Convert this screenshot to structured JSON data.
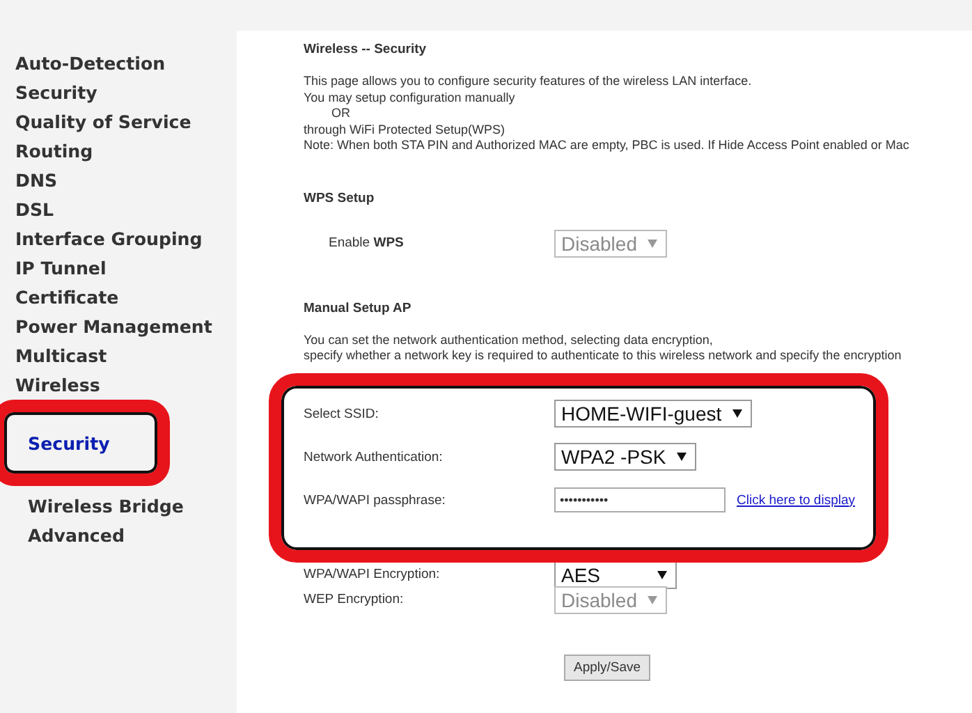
{
  "sidebar": {
    "items": [
      {
        "label": "Auto-Detection",
        "selected": false
      },
      {
        "label": "Security",
        "selected": false
      },
      {
        "label": "Quality of Service",
        "selected": false
      },
      {
        "label": "Routing",
        "selected": false
      },
      {
        "label": "DNS",
        "selected": false
      },
      {
        "label": "DSL",
        "selected": false
      },
      {
        "label": "Interface Grouping",
        "selected": false
      },
      {
        "label": "IP Tunnel",
        "selected": false
      },
      {
        "label": "Certificate",
        "selected": false
      },
      {
        "label": "Power Management",
        "selected": false
      },
      {
        "label": "Multicast",
        "selected": false
      },
      {
        "label": "Wireless",
        "selected": false,
        "children": [
          {
            "label": "Security",
            "selected": true
          },
          {
            "label": "Wireless Bridge",
            "selected": false
          },
          {
            "label": "Advanced",
            "selected": false
          }
        ]
      }
    ]
  },
  "page": {
    "title": "Wireless -- Security",
    "intro": [
      "This page allows you to configure security features of the wireless LAN interface.",
      "You may setup configuration manually",
      "OR",
      "through WiFi Protected Setup(WPS)",
      "Note: When both STA PIN and Authorized MAC are empty, PBC is used. If Hide Access Point enabled or Mac"
    ]
  },
  "wps": {
    "heading": "WPS Setup",
    "label": "Enable **WPS**",
    "value": "Disabled",
    "disabled": true
  },
  "manual": {
    "heading": "Manual Setup AP",
    "description": [
      "You can set the network authentication method, selecting data encryption,",
      "specify whether a network key is required to authenticate to this wireless network and specify the encryption"
    ],
    "fields": [
      {
        "kind": "select",
        "label": "Select SSID:",
        "value": "HOME-WIFI-guest",
        "disabled": false,
        "highlighted": true
      },
      {
        "kind": "select",
        "label": "Network Authentication:",
        "value": "WPA2 -PSK",
        "disabled": false,
        "highlighted": true
      },
      {
        "kind": "password",
        "label": "WPA/WAPI passphrase:",
        "value": "•••••••••••",
        "link": "Click here to display",
        "highlighted": true
      },
      {
        "kind": "select",
        "label": "WPA/WAPI Encryption:",
        "value": "AES",
        "disabled": false,
        "highlighted": false
      },
      {
        "kind": "select",
        "label": "WEP Encryption:",
        "value": "Disabled",
        "disabled": true,
        "highlighted": false
      }
    ]
  },
  "apply_button": "Apply/Save"
}
